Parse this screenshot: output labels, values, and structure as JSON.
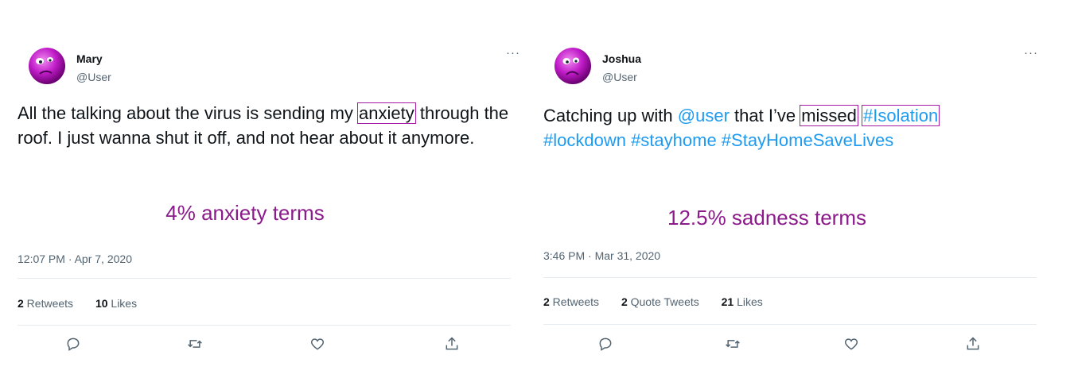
{
  "tweets": [
    {
      "author": {
        "name": "Mary",
        "handle": "@User",
        "avatar_color": "#c01cc8"
      },
      "more_label": "···",
      "text_before": "All the talking about the virus is sending my ",
      "highlight_1": "anxiety",
      "text_after": " through the roof. I just wanna shut it off, and not hear about it anymore.",
      "stat_caption": "4% anxiety terms",
      "timestamp": "12:07 PM · Apr 7, 2020",
      "retweets": {
        "count": "2",
        "label": " Retweets"
      },
      "likes": {
        "count": "10",
        "label": " Likes"
      },
      "actions": [
        "reply-icon",
        "retweet-icon",
        "like-icon",
        "share-icon"
      ]
    },
    {
      "author": {
        "name": "Joshua",
        "handle": "@User",
        "avatar_color": "#c01cc8"
      },
      "more_label": "···",
      "text_before": "Catching up with ",
      "mention": "@user",
      "text_mid": " that I’ve ",
      "highlight_1": "missed",
      "highlight_2": "#Isolation",
      "tags": "#lockdown #stayhome #StayHomeSaveLives",
      "stat_caption": "12.5% sadness terms",
      "timestamp": "3:46 PM · Mar 31, 2020",
      "retweets": {
        "count": "2",
        "label": " Retweets"
      },
      "quotes": {
        "count": "2",
        "label": " Quote Tweets"
      },
      "likes": {
        "count": "21",
        "label": " Likes"
      },
      "actions": [
        "reply-icon",
        "retweet-icon",
        "like-icon",
        "share-icon"
      ]
    }
  ],
  "colors": {
    "link": "#1d9bf0",
    "highlight_box": "#a61ca6",
    "caption": "#8b1a8b",
    "muted": "#536471"
  }
}
